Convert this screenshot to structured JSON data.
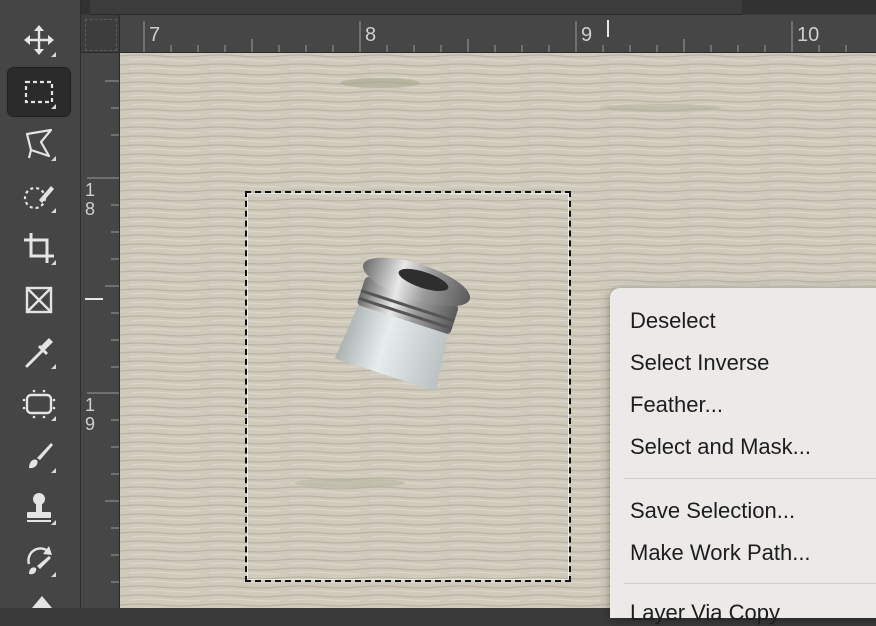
{
  "toolbar": {
    "tools": [
      {
        "name": "move-tool",
        "icon": "move-icon",
        "active": false
      },
      {
        "name": "rectangular-marquee-tool",
        "icon": "marquee-icon",
        "active": true
      },
      {
        "name": "polygonal-lasso-tool",
        "icon": "lasso-icon",
        "active": false
      },
      {
        "name": "quick-selection-tool",
        "icon": "quick-selection-icon",
        "active": false
      },
      {
        "name": "crop-tool",
        "icon": "crop-icon",
        "active": false
      },
      {
        "name": "frame-tool",
        "icon": "frame-icon",
        "active": false
      },
      {
        "name": "eyedropper-tool",
        "icon": "eyedropper-icon",
        "active": false
      },
      {
        "name": "spot-healing-tool",
        "icon": "bandage-icon",
        "active": false
      },
      {
        "name": "brush-tool",
        "icon": "brush-icon",
        "active": false
      },
      {
        "name": "clone-stamp-tool",
        "icon": "stamp-icon",
        "active": false
      },
      {
        "name": "history-brush-tool",
        "icon": "history-brush-icon",
        "active": false
      }
    ]
  },
  "rulers": {
    "horizontal": [
      "7",
      "8",
      "9",
      "10"
    ],
    "vertical": [
      [
        "1",
        "8"
      ],
      [
        "1",
        "9"
      ]
    ]
  },
  "context_menu": {
    "items": [
      "Deselect",
      "Select Inverse",
      "Feather...",
      "Select and Mask...",
      "Save Selection...",
      "Make Work Path...",
      "Layer Via Copy"
    ]
  },
  "colors": {
    "toolbar_bg": "#454545",
    "active_tool_bg": "#2b2b2b",
    "canvas_bg": "#cfcabb",
    "menu_bg": "#eceae8"
  }
}
